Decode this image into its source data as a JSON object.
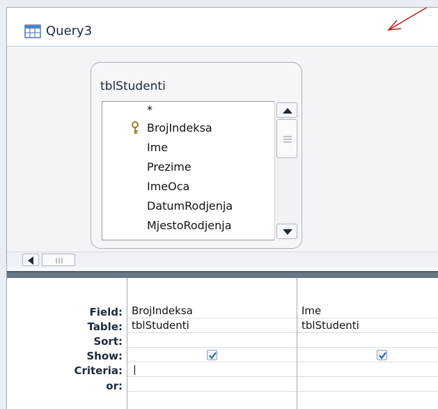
{
  "window": {
    "title": "Query3"
  },
  "table_box": {
    "title": "tblStudenti",
    "fields": [
      "*",
      "BrojIndeksa",
      "Ime",
      "Prezime",
      "ImeOca",
      "DatumRodjenja",
      "MjestoRodjenja"
    ],
    "primary_key": "BrojIndeksa"
  },
  "grid": {
    "row_labels": [
      "Field:",
      "Table:",
      "Sort:",
      "Show:",
      "Criteria:",
      "or:"
    ],
    "columns": [
      {
        "field": "BrojIndeksa",
        "table": "tblStudenti",
        "sort": "",
        "show": true,
        "criteria": ""
      },
      {
        "field": "Ime",
        "table": "tblStudenti",
        "sort": "",
        "show": true,
        "criteria": ""
      }
    ]
  },
  "colors": {
    "splitter": "#6b7787",
    "annotation_arrow": "#c0161a"
  },
  "icons": {
    "window": "query-table-icon",
    "key": "key-icon"
  }
}
